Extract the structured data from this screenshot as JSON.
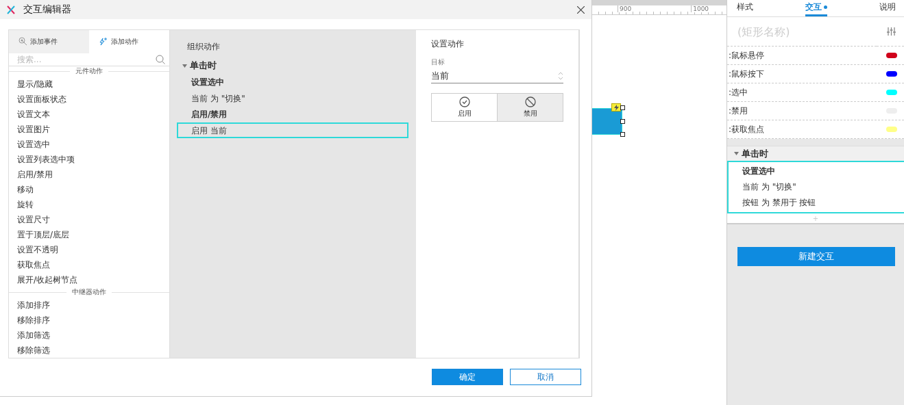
{
  "dialog": {
    "title": "交互编辑器",
    "left_tabs": [
      {
        "label": "添加事件",
        "selected": false
      },
      {
        "label": "添加动作",
        "selected": true
      }
    ],
    "search": {
      "placeholder": "搜索..."
    },
    "action_groups": [
      {
        "title": "元件动作",
        "items": [
          "显示/隐藏",
          "设置面板状态",
          "设置文本",
          "设置图片",
          "设置选中",
          "设置列表选中项",
          "启用/禁用",
          "移动",
          "旋转",
          "设置尺寸",
          "置于顶层/底层",
          "设置不透明",
          "获取焦点",
          "展开/收起树节点"
        ]
      },
      {
        "title": "中继器动作",
        "items": [
          "添加排序",
          "移除排序",
          "添加筛选",
          "移除筛选"
        ]
      }
    ],
    "organize": {
      "title": "组织动作",
      "event": {
        "label": "单击时",
        "expanded": true,
        "actions": [
          {
            "title": "设置选中",
            "items": [
              {
                "text": "当前 为 \"切换\"",
                "selected": false
              }
            ]
          },
          {
            "title": "启用/禁用",
            "items": [
              {
                "text": "启用 当前",
                "selected": true
              }
            ]
          }
        ]
      }
    },
    "settings": {
      "title": "设置动作",
      "target_label": "目标",
      "target_value": "当前",
      "options": [
        {
          "kind": "enable",
          "label": "启用",
          "selected": true
        },
        {
          "kind": "disable",
          "label": "禁用",
          "selected": false
        }
      ]
    },
    "buttons": [
      {
        "label": "确定",
        "primary": true
      },
      {
        "label": "取消",
        "primary": false
      }
    ]
  },
  "ruler": {
    "ticks": [
      "900",
      "1000"
    ]
  },
  "inspector": {
    "tabs": [
      {
        "label": "样式",
        "selected": false,
        "dot": false
      },
      {
        "label": "交互",
        "selected": true,
        "dot": true
      },
      {
        "label": "说明",
        "selected": false,
        "dot": false
      }
    ],
    "name_placeholder": "(矩形名称)",
    "states": [
      {
        "label": ":鼠标悬停",
        "color": "#d0021b"
      },
      {
        "label": ":鼠标按下",
        "color": "#0000ff"
      },
      {
        "label": ":选中",
        "color": "#00ffff"
      },
      {
        "label": ":禁用",
        "color": "#eeeeee"
      },
      {
        "label": ":获取焦点",
        "color": "#ffff88"
      }
    ],
    "event": {
      "label": "单击时",
      "expanded": true,
      "lines": [
        {
          "text": "设置选中",
          "bold": true
        },
        {
          "text": "当前 为 \"切换\"",
          "bold": false
        },
        {
          "text": "按钮 为 禁用于 按钮",
          "bold": false
        }
      ]
    },
    "add_label": "+",
    "new_button": "新建交互"
  }
}
